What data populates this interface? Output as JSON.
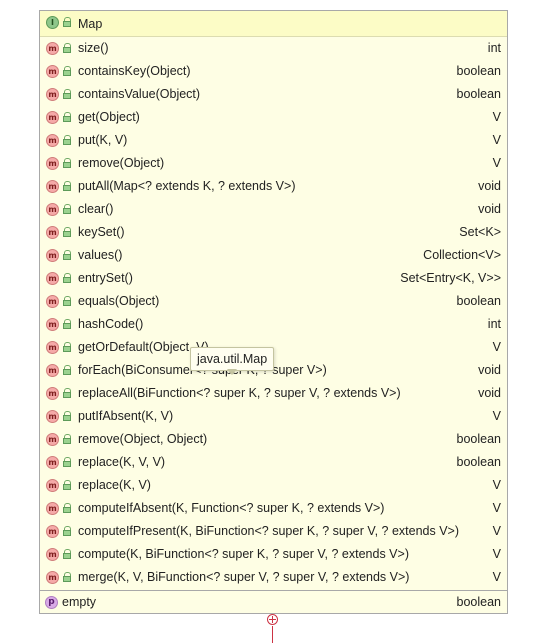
{
  "interface": {
    "badge": "I",
    "name": "Map",
    "icon": "interface-icon"
  },
  "methods": [
    {
      "name": "size()",
      "type": "int"
    },
    {
      "name": "containsKey(Object)",
      "type": "boolean"
    },
    {
      "name": "containsValue(Object)",
      "type": "boolean"
    },
    {
      "name": "get(Object)",
      "type": "V"
    },
    {
      "name": "put(K, V)",
      "type": "V"
    },
    {
      "name": "remove(Object)",
      "type": "V"
    },
    {
      "name": "putAll(Map<? extends K, ? extends V>)",
      "type": "void"
    },
    {
      "name": "clear()",
      "type": "void"
    },
    {
      "name": "keySet()",
      "type": "Set<K>"
    },
    {
      "name": "values()",
      "type": "Collection<V>"
    },
    {
      "name": "entrySet()",
      "type": "Set<Entry<K, V>>"
    },
    {
      "name": "equals(Object)",
      "type": "boolean"
    },
    {
      "name": "hashCode()",
      "type": "int"
    },
    {
      "name": "getOrDefault(Object, V)",
      "type": "V"
    },
    {
      "name": "forEach(BiConsumer<? super K, ? super V>)",
      "type": "void"
    },
    {
      "name": "replaceAll(BiFunction<? super K, ? super V, ? extends V>)",
      "type": "void"
    },
    {
      "name": "putIfAbsent(K, V)",
      "type": "V"
    },
    {
      "name": "remove(Object, Object)",
      "type": "boolean"
    },
    {
      "name": "replace(K, V, V)",
      "type": "boolean"
    },
    {
      "name": "replace(K, V)",
      "type": "V"
    },
    {
      "name": "computeIfAbsent(K, Function<? super K, ? extends V>)",
      "type": "V"
    },
    {
      "name": "computeIfPresent(K, BiFunction<? super K, ? super V, ? extends V>)",
      "type": "V"
    },
    {
      "name": "compute(K, BiFunction<? super K, ? super V, ? extends V>)",
      "type": "V"
    },
    {
      "name": "merge(K, V, BiFunction<? super V, ? super V, ? extends V>)",
      "type": "V"
    }
  ],
  "method_badge": "m",
  "field": {
    "badge": "p",
    "name": "empty",
    "type": "boolean"
  },
  "tooltip": {
    "text": "java.util.Map"
  }
}
